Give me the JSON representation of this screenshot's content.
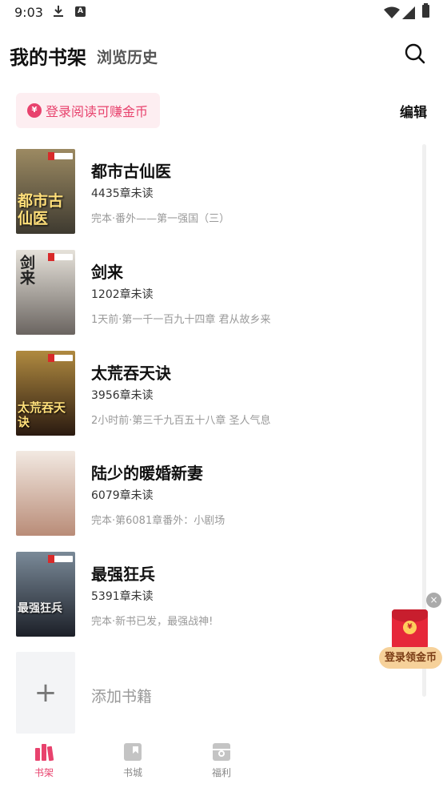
{
  "status_bar": {
    "time": "9:03",
    "badge_a": "A"
  },
  "header": {
    "title": "我的书架",
    "history_tab": "浏览历史"
  },
  "login_banner": {
    "coin_symbol": "¥",
    "text": "登录阅读可赚金币"
  },
  "edit_label": "编辑",
  "books": [
    {
      "name": "都市古仙医",
      "unread": "4435章未读",
      "latest": "完本·番外——第一强国（三）",
      "cover_text": "都市古仙医",
      "cover_colors": [
        "#6b5a3a",
        "#3e3a30"
      ]
    },
    {
      "name": "剑来",
      "unread": "1202章未读",
      "latest": "1天前·第一千一百九十四章 君从故乡来",
      "cover_text": "剑来",
      "cover_colors": [
        "#d8d4cc",
        "#6a6460"
      ]
    },
    {
      "name": "太荒吞天诀",
      "unread": "3956章未读",
      "latest": "2小时前·第三千九百五十八章 圣人气息",
      "cover_text": "太荒吞天诀",
      "cover_colors": [
        "#8a6a2a",
        "#2a1a10"
      ]
    },
    {
      "name": "陆少的暖婚新妻",
      "unread": "6079章未读",
      "latest": "完本·第6081章番外：小剧场",
      "cover_text": "",
      "cover_colors": [
        "#f2e9e2",
        "#b98c78"
      ]
    },
    {
      "name": "最强狂兵",
      "unread": "5391章未读",
      "latest": "完本·新书已发，最强战神!",
      "cover_text": "最强狂兵",
      "cover_colors": [
        "#5a6a78",
        "#1c2028"
      ]
    }
  ],
  "add_book": {
    "plus": "+",
    "label": "添加书籍"
  },
  "promo": {
    "close": "×",
    "coin_symbol": "¥",
    "label": "登录领金币"
  },
  "nav": [
    {
      "label": "书架",
      "icon": "bookshelf-icon",
      "active": true
    },
    {
      "label": "书城",
      "icon": "bookstore-icon",
      "active": false
    },
    {
      "label": "福利",
      "icon": "gift-icon",
      "active": false
    }
  ],
  "colors": {
    "accent": "#e8426d",
    "pill_bg": "#fdeef1",
    "promo_red": "#e6273a",
    "promo_gold": "#f6d19a"
  }
}
